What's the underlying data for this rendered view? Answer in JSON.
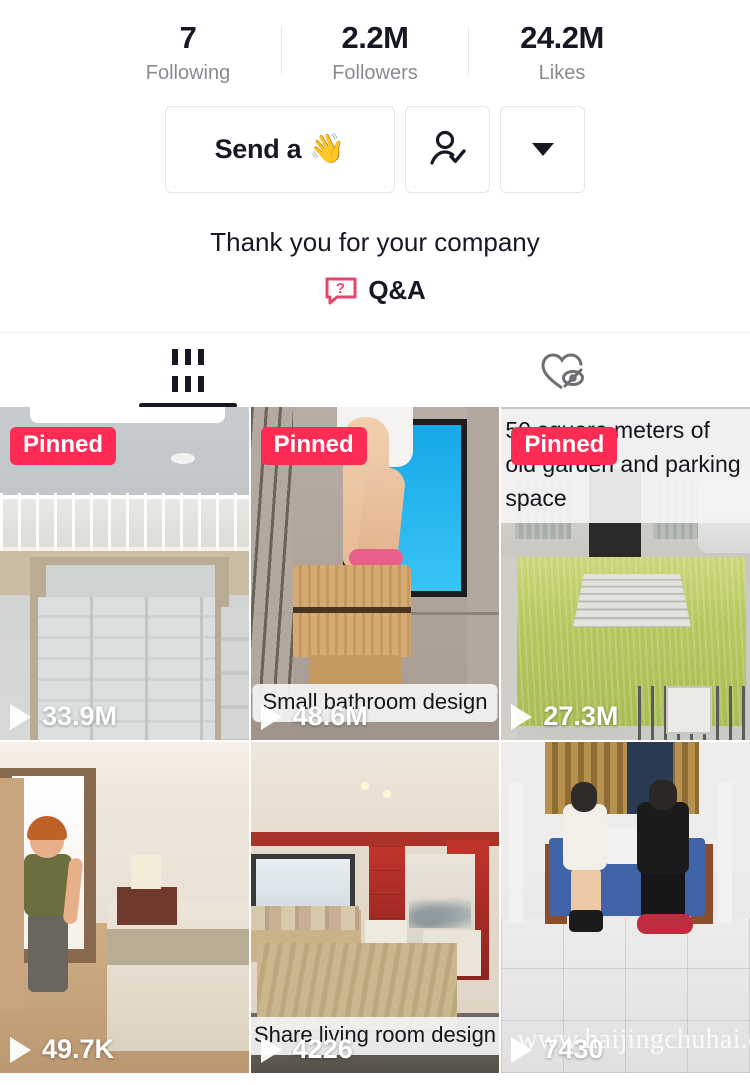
{
  "profile": {
    "stats": [
      {
        "value": "7",
        "label": "Following",
        "name": "following"
      },
      {
        "value": "2.2M",
        "label": "Followers",
        "name": "followers"
      },
      {
        "value": "24.2M",
        "label": "Likes",
        "name": "likes"
      }
    ],
    "actions": {
      "message_label": "Send a",
      "message_emoji": "👋",
      "follow_icon": "person-check-icon",
      "more_icon": "chevron-down-icon"
    },
    "bio": "Thank you for your company",
    "qa": {
      "label": "Q&A",
      "icon": "question-bubble-icon"
    }
  },
  "tabs": [
    {
      "id": "videos",
      "icon": "grid-icon",
      "active": true
    },
    {
      "id": "liked",
      "icon": "heart-hidden-icon",
      "active": false
    }
  ],
  "videos": [
    {
      "id": "video-1",
      "views": "33.9M",
      "pinned_label": "Pinned",
      "caption": "",
      "scene": "loft-bed-storage-room"
    },
    {
      "id": "video-2",
      "views": "48.6M",
      "pinned_label": "Pinned",
      "caption": "Small bathroom design",
      "scene": "small-bathroom-wooden-tub"
    },
    {
      "id": "video-3",
      "views": "27.3M",
      "pinned_label": "Pinned",
      "caption": "50 square meters of old garden and parking space",
      "scene": "overgrown-garden-parking"
    },
    {
      "id": "video-4",
      "views": "49.7K",
      "pinned_label": "",
      "caption": "",
      "scene": "3d-bedroom-walkthrough"
    },
    {
      "id": "video-5",
      "views": "4226",
      "pinned_label": "",
      "caption": "Share living room design",
      "scene": "chinese-style-living-room"
    },
    {
      "id": "video-6",
      "views": "7430",
      "pinned_label": "",
      "caption": "",
      "watermark": "www.haijingchuhai.com",
      "scene": "two-people-blue-sofa"
    }
  ],
  "colors": {
    "accent_pinned": "#FE2C55",
    "text_primary": "#161823",
    "text_secondary": "#8A8B91",
    "qa_icon": "#E8456B",
    "border": "#E6E6E8"
  }
}
